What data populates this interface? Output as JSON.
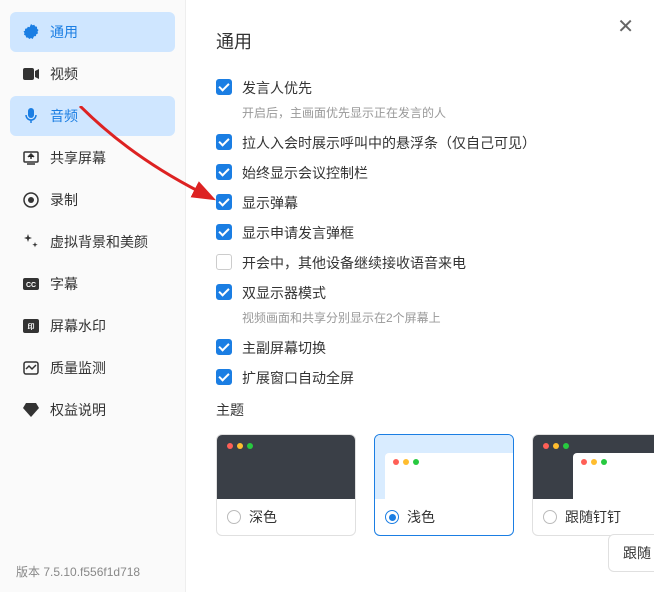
{
  "sidebar": {
    "items": [
      {
        "label": "通用",
        "icon": "gear"
      },
      {
        "label": "视频",
        "icon": "video"
      },
      {
        "label": "音频",
        "icon": "mic"
      },
      {
        "label": "共享屏幕",
        "icon": "share"
      },
      {
        "label": "录制",
        "icon": "record"
      },
      {
        "label": "虚拟背景和美颜",
        "icon": "bg"
      },
      {
        "label": "字幕",
        "icon": "cc"
      },
      {
        "label": "屏幕水印",
        "icon": "watermark"
      },
      {
        "label": "质量监测",
        "icon": "quality"
      },
      {
        "label": "权益说明",
        "icon": "rights"
      }
    ]
  },
  "version": "版本 7.5.10.f556f1d718",
  "page_title": "通用",
  "options": {
    "speaker_priority": {
      "label": "发言人优先",
      "checked": true,
      "hint": "开启后，主画面优先显示正在发言的人"
    },
    "pull_join": {
      "label": "拉人入会时展示呼叫中的悬浮条（仅自己可见）",
      "checked": true
    },
    "always_show_bar": {
      "label": "始终显示会议控制栏",
      "checked": true
    },
    "show_danmu": {
      "label": "显示弹幕",
      "checked": true
    },
    "show_request_frame": {
      "label": "显示申请发言弹框",
      "checked": true
    },
    "continue_voice": {
      "label": "开会中，其他设备继续接收语音来电",
      "checked": false
    },
    "dual_monitor": {
      "label": "双显示器模式",
      "checked": true,
      "hint": "视频画面和共享分别显示在2个屏幕上"
    },
    "main_sub_switch": {
      "label": "主副屏幕切换",
      "checked": true
    },
    "expand_fullscreen": {
      "label": "扩展窗口自动全屏",
      "checked": true
    }
  },
  "theme": {
    "label": "主题",
    "options": {
      "dark": "深色",
      "light": "浅色",
      "follow": "跟随钉钉"
    },
    "selected": "light"
  },
  "follow_button": "跟随"
}
